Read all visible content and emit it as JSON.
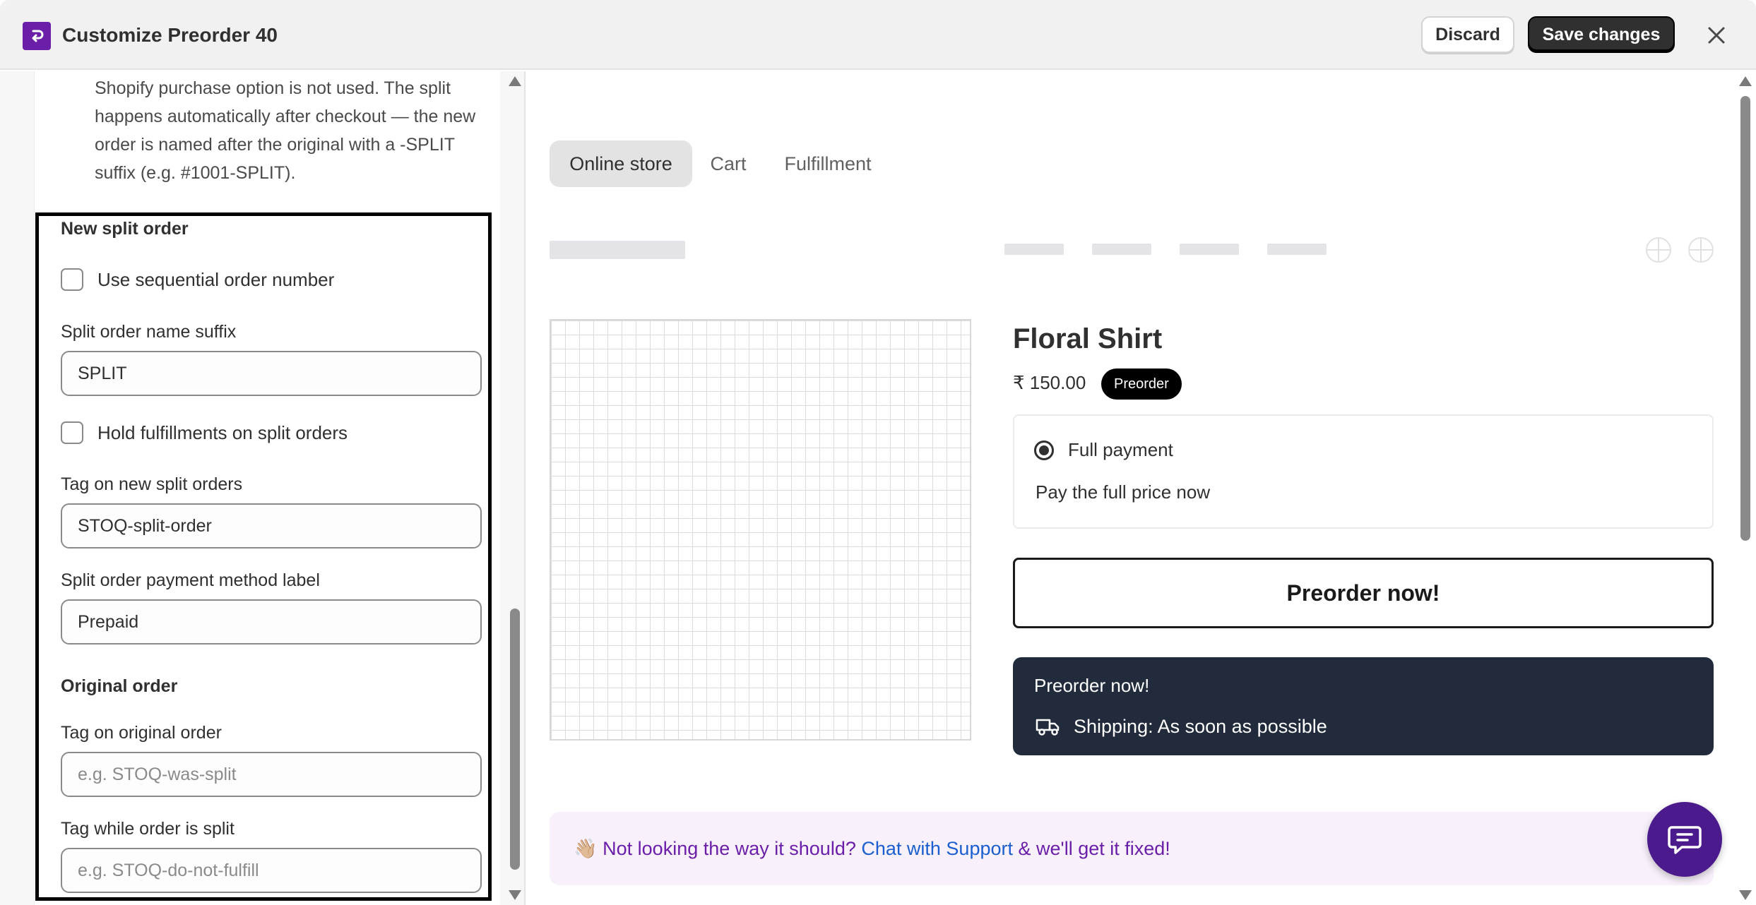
{
  "header": {
    "title": "Customize Preorder 40",
    "discard_label": "Discard",
    "save_label": "Save changes",
    "logo_icon": "app-logo-icon",
    "close_icon": "close-icon"
  },
  "settings": {
    "intro_text": "Shopify purchase option is not used. The split happens automatically after checkout — the new order is named after the original with a -SPLIT suffix (e.g. #1001-SPLIT).",
    "new_split_heading": "New split order",
    "use_sequential_label": "Use sequential order number",
    "use_sequential_checked": false,
    "suffix_label": "Split order name suffix",
    "suffix_value": "SPLIT",
    "hold_fulfillments_label": "Hold fulfillments on split orders",
    "hold_fulfillments_checked": false,
    "tag_new_label": "Tag on new split orders",
    "tag_new_value": "STOQ-split-order",
    "payment_label_label": "Split order payment method label",
    "payment_label_value": "Prepaid",
    "original_heading": "Original order",
    "tag_original_label": "Tag on original order",
    "tag_original_placeholder": "e.g. STOQ-was-split",
    "tag_while_label": "Tag while order is split",
    "tag_while_placeholder": "e.g. STOQ-do-not-fulfill"
  },
  "preview": {
    "tabs": [
      {
        "label": "Online store",
        "active": true
      },
      {
        "label": "Cart",
        "active": false
      },
      {
        "label": "Fulfillment",
        "active": false
      }
    ],
    "product": {
      "title": "Floral Shirt",
      "price": "₹ 150.00",
      "badge": "Preorder",
      "option_label": "Full payment",
      "option_desc": "Pay the full price now",
      "button_label": "Preorder now!",
      "card_title": "Preorder now!",
      "shipping_text": "Shipping: As soon as possible"
    },
    "support": {
      "emoji": "👋🏼",
      "prefix": "Not looking the way it should?",
      "link": "Chat with Support",
      "suffix": "& we'll get it fixed!"
    }
  },
  "colors": {
    "accent_purple": "#6b1fa8",
    "dark_card": "#212b3b",
    "link_blue": "#1b5fcf",
    "chat_fab": "#4b1a8c"
  }
}
